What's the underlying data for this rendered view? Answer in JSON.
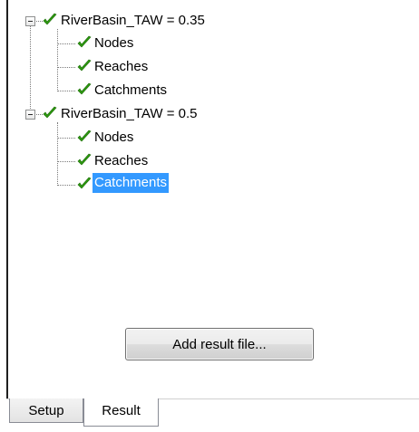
{
  "tree": {
    "groups": [
      {
        "label": "RiverBasin_TAW = 0.35",
        "checked": true,
        "expanded": true,
        "children": [
          {
            "label": "Nodes",
            "checked": true,
            "selected": false
          },
          {
            "label": "Reaches",
            "checked": true,
            "selected": false
          },
          {
            "label": "Catchments",
            "checked": true,
            "selected": false
          }
        ]
      },
      {
        "label": "RiverBasin_TAW = 0.5",
        "checked": true,
        "expanded": true,
        "children": [
          {
            "label": "Nodes",
            "checked": true,
            "selected": false
          },
          {
            "label": "Reaches",
            "checked": true,
            "selected": false
          },
          {
            "label": "Catchments",
            "checked": true,
            "selected": true
          }
        ]
      }
    ]
  },
  "add_button": {
    "label": "Add result file..."
  },
  "tabs": [
    {
      "label": "Setup",
      "active": false
    },
    {
      "label": "Result",
      "active": true
    }
  ],
  "icons": {
    "check": "check-icon",
    "collapse": "minus-expander-icon"
  },
  "colors": {
    "selection": "#3399ff",
    "check_green": "#2e9a10",
    "button_border": "#707070"
  }
}
